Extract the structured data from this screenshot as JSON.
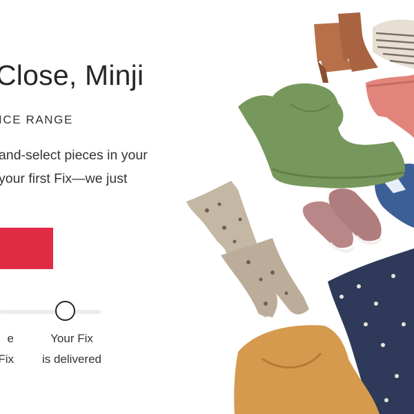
{
  "hero": {
    "heading": "Close, Minji",
    "eyebrow": "ICE RANGE",
    "body_lines": [
      "and-select pieces in your",
      "your first Fix—we just"
    ],
    "cta_label": ""
  },
  "steps": {
    "left_lines": [
      "e",
      "Fix"
    ],
    "right_lines": [
      "Your Fix",
      "is delivered"
    ]
  },
  "colors": {
    "cta": "#e02b43",
    "heading": "#262626"
  }
}
